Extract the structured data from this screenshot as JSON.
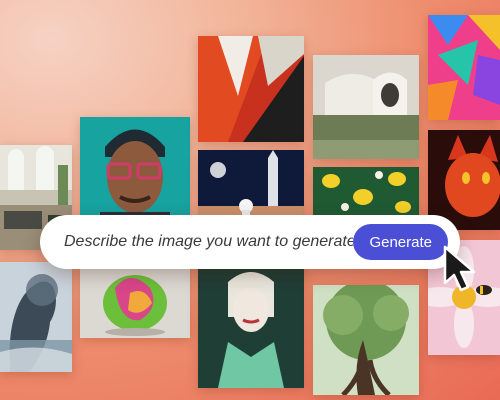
{
  "prompt_bar": {
    "placeholder": "Describe the image you want to generate",
    "generate_label": "Generate"
  },
  "colors": {
    "background_light": "#f6d2c4",
    "background_dark": "#e96a55",
    "button": "#4a4fd6",
    "button_text": "#ffffff"
  },
  "gallery": [
    "interior-room",
    "man-with-glasses-portrait",
    "red-white-abstract-paint",
    "modern-house-architecture",
    "colorful-paper-shapes",
    "astronaut-rocket-scene",
    "lemon-pattern",
    "red-cat-portrait",
    "double-exposure-woman-ocean",
    "colorful-abstract-sculpture",
    "art-deco-woman-portrait",
    "twisted-tree-illustration",
    "flower-with-bee"
  ]
}
